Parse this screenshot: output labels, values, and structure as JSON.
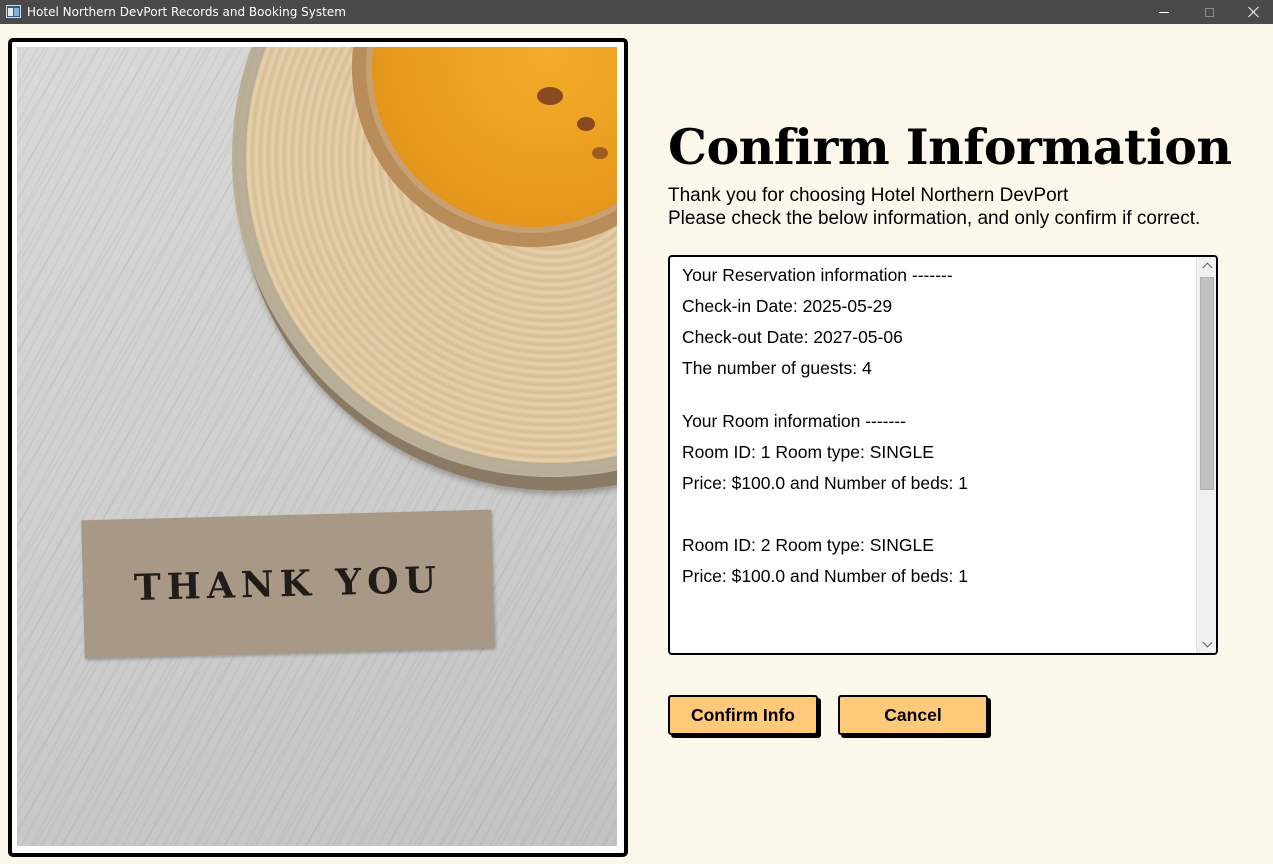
{
  "window": {
    "title": "Hotel Northern DevPort Records and Booking System"
  },
  "photo": {
    "tag_text": "THANK YOU"
  },
  "page": {
    "heading": "Confirm Information",
    "subtext_line1": "Thank you for choosing Hotel Northern DevPort",
    "subtext_line2": "Please check the below information, and only confirm if correct."
  },
  "reservation": {
    "header": "Your Reservation information -------",
    "check_in": "Check-in Date: 2025-05-29",
    "check_out": "Check-out Date: 2027-05-06",
    "guests": "The number of guests: 4"
  },
  "rooms": {
    "header": "Your Room information -------",
    "items": [
      {
        "id_type": "Room ID: 1 Room type: SINGLE",
        "price_beds": "Price: $100.0 and Number of beds: 1"
      },
      {
        "id_type": "Room ID: 2 Room type: SINGLE",
        "price_beds": "Price: $100.0 and Number of beds: 1"
      }
    ]
  },
  "buttons": {
    "confirm_label": "Confirm Info",
    "cancel_label": "Cancel"
  },
  "colors": {
    "background": "#fdf8ec",
    "button": "#ffc97a",
    "titlebar": "#4a4a4a"
  }
}
